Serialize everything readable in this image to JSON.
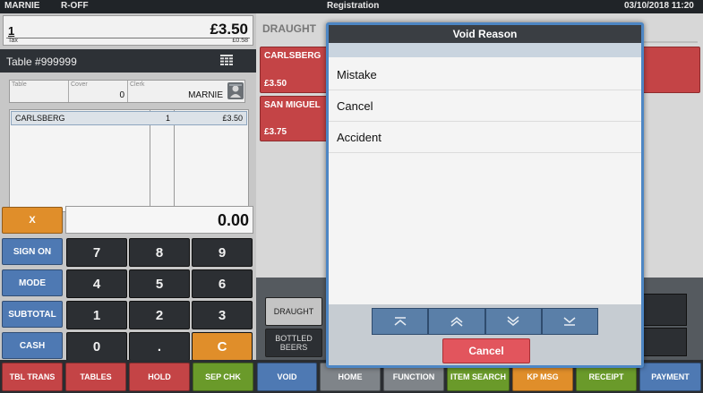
{
  "colors": {
    "accent_blue": "#4e79b3",
    "orange": "#e08e2a",
    "product_red": "#c44446",
    "green": "#6a9a2a",
    "dark": "#2c2f33"
  },
  "topbar": {
    "user": "MARNIE",
    "mode": "R-OFF",
    "title": "Registration",
    "datetime": "03/10/2018 11:20"
  },
  "total": {
    "qty": "1",
    "amount": "£3.50",
    "tax_label": "Tax",
    "tax_value": "£0.58"
  },
  "table": {
    "label": "Table  #999999",
    "icon": "grid-list-icon"
  },
  "info": {
    "table_label": "Table",
    "table_value": "",
    "cover_label": "Cover",
    "cover_value": "0",
    "clerk_label": "Clerk",
    "clerk_value": "MARNIE",
    "clerk_icon": "person-icon"
  },
  "items": [
    {
      "name": "CARLSBERG",
      "qty": "1",
      "price": "£3.50"
    }
  ],
  "entry": {
    "clear_label": "X",
    "display_value": "0.00"
  },
  "functions": [
    "SIGN ON",
    "MODE",
    "SUBTOTAL",
    "CASH"
  ],
  "keypad": [
    [
      "7",
      "8",
      "9"
    ],
    [
      "4",
      "5",
      "6"
    ],
    [
      "1",
      "2",
      "3"
    ],
    [
      "0",
      ".",
      "C"
    ]
  ],
  "grid": {
    "category_title": "DRAUGHT",
    "products": [
      {
        "name": "CARLSBERG",
        "price": "£3.50"
      },
      {
        "name": "SAN MIGUEL",
        "price": "£3.75"
      }
    ]
  },
  "categories": [
    "DRAUGHT",
    "BOTTLED BEERS"
  ],
  "bottom_buttons": [
    {
      "label": "TBL TRANS",
      "color": "#c44446"
    },
    {
      "label": "TABLES",
      "color": "#c44446"
    },
    {
      "label": "HOLD",
      "color": "#c44446"
    },
    {
      "label": "SEP CHK",
      "color": "#6a9a2a"
    },
    {
      "label": "VOID",
      "color": "#4e79b3"
    },
    {
      "label": "HOME",
      "color": "#7f8489"
    },
    {
      "label": "FUNCTION",
      "color": "#7f8489"
    },
    {
      "label": "ITEM SEARCH",
      "color": "#6a9a2a"
    },
    {
      "label": "KP MSG",
      "color": "#e08e2a"
    },
    {
      "label": "RECEIPT",
      "color": "#6a9a2a"
    },
    {
      "label": "PAYMENT",
      "color": "#4e79b3"
    }
  ],
  "dialog": {
    "title": "Void Reason",
    "reasons": [
      "Mistake",
      "Cancel",
      "Accident"
    ],
    "nav_icons": [
      "first-page-icon",
      "page-up-icon",
      "page-down-icon",
      "last-page-icon"
    ],
    "cancel_label": "Cancel"
  }
}
